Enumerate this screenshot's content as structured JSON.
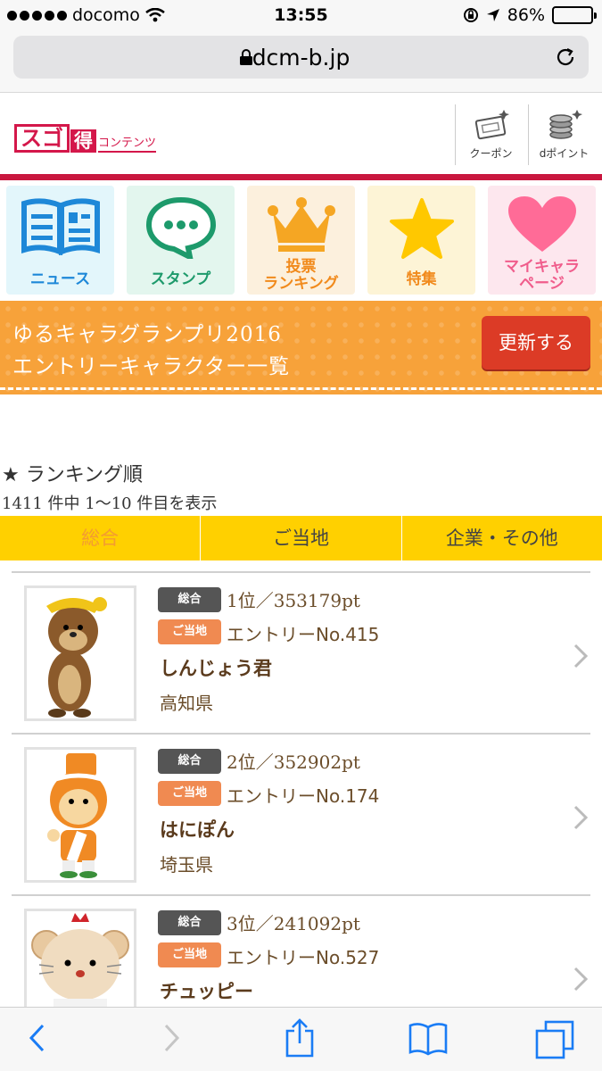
{
  "status": {
    "carrier": "docomo",
    "time": "13:55",
    "battery": "86%",
    "battery_level": 0.86
  },
  "browser": {
    "url": "dcm-b.jp"
  },
  "header": {
    "logo_main": "スゴ",
    "logo_accent": "得",
    "logo_sub": "コンテンツ",
    "coupon_label": "クーポン",
    "points_label": "dポイント"
  },
  "menu": [
    {
      "label": "ニュース",
      "color": "#1e88d8",
      "bg": "#e3f6fb"
    },
    {
      "label": "スタンプ",
      "color": "#1d9a6b",
      "bg": "#e3f6ee"
    },
    {
      "label": "投票\nランキング",
      "color": "#f18a1c",
      "bg": "#fcf0dd"
    },
    {
      "label": "特集",
      "color": "#f18a1c",
      "bg": "#fdf4d6"
    },
    {
      "label": "マイキャラ\nページ",
      "color": "#f05d8c",
      "bg": "#fde7ee"
    }
  ],
  "banner": {
    "line1": "ゆるキャラグランプリ2016",
    "line2": "エントリーキャラクター一覧",
    "button": "更新する"
  },
  "ranking": {
    "title": "★ ランキング順",
    "count": "1411 件中 1〜10 件目を表示"
  },
  "tabs": [
    "総合",
    "ご当地",
    "企業・その他"
  ],
  "items": [
    {
      "badge_all": "総合",
      "rank": "1位／353179pt",
      "badge_local": "ご当地",
      "entry": "エントリーNo.415",
      "name": "しんじょう君",
      "pref": "高知県"
    },
    {
      "badge_all": "総合",
      "rank": "2位／352902pt",
      "badge_local": "ご当地",
      "entry": "エントリーNo.174",
      "name": "はにぽん",
      "pref": "埼玉県"
    },
    {
      "badge_all": "総合",
      "rank": "3位／241092pt",
      "badge_local": "ご当地",
      "entry": "エントリーNo.527",
      "name": "チュッピー",
      "pref": ""
    }
  ]
}
